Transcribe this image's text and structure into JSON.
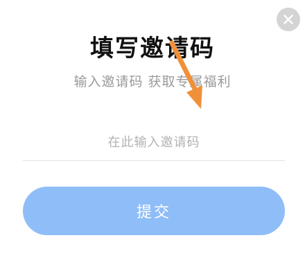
{
  "dialog": {
    "title": "填写邀请码",
    "subtitle": "输入邀请码 获取专属福利",
    "input": {
      "value": "",
      "placeholder": "在此输入邀请码"
    },
    "submit_label": "提交",
    "close_icon": "close-icon",
    "annotation_icon": "arrow-down-icon"
  },
  "colors": {
    "submit_button": "#8fbdf8",
    "close_button": "#d4d4d4",
    "annotation_arrow": "#f0913a",
    "title_text": "#111111",
    "subtitle_text": "#9a9a9a",
    "placeholder_text": "#b2b2b2"
  }
}
